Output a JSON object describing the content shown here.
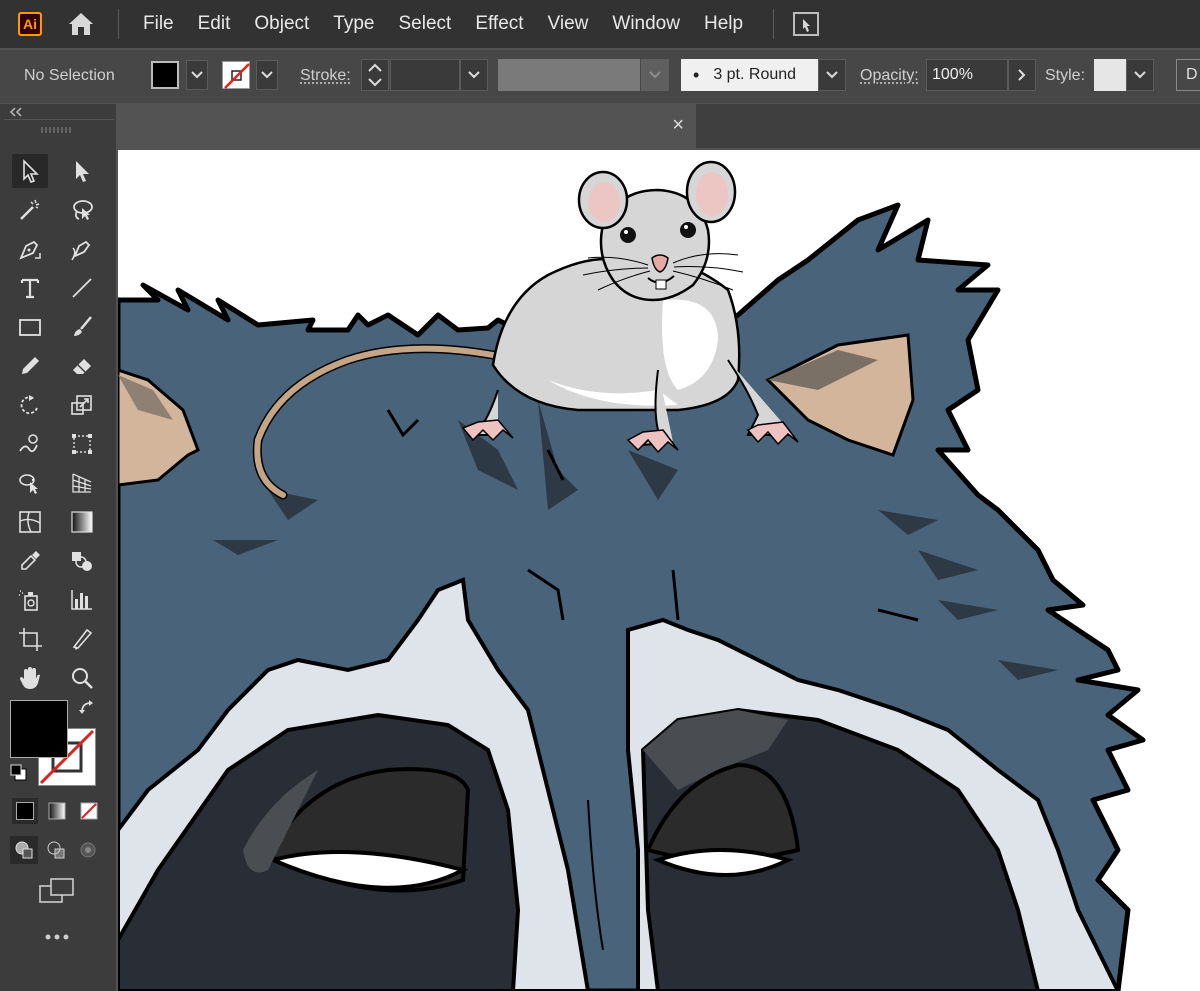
{
  "app": {
    "logo": "Ai"
  },
  "menu": {
    "items": [
      "File",
      "Edit",
      "Object",
      "Type",
      "Select",
      "Effect",
      "View",
      "Window",
      "Help"
    ]
  },
  "control": {
    "selection_status": "No Selection",
    "stroke_label": "Stroke:",
    "brush_value": "3 pt. Round",
    "opacity_label": "Opacity:",
    "opacity_value": "100%",
    "style_label": "Style:",
    "cut_off_label": "D"
  },
  "colors": {
    "fill": "#000000",
    "stroke": "none",
    "accent_logo": "#ff9a00",
    "raccoon_fur": "#48637a",
    "raccoon_mask": "#292e36",
    "raccoon_white": "#dfe3ea",
    "mouse_body": "#d6d6d6"
  },
  "icons": {
    "home": "home-icon",
    "arrange": "arrange-documents-icon",
    "close_tab": "close-icon",
    "collapse_panel": "double-chevron-left-icon"
  },
  "tab": {
    "close_glyph": "×"
  }
}
